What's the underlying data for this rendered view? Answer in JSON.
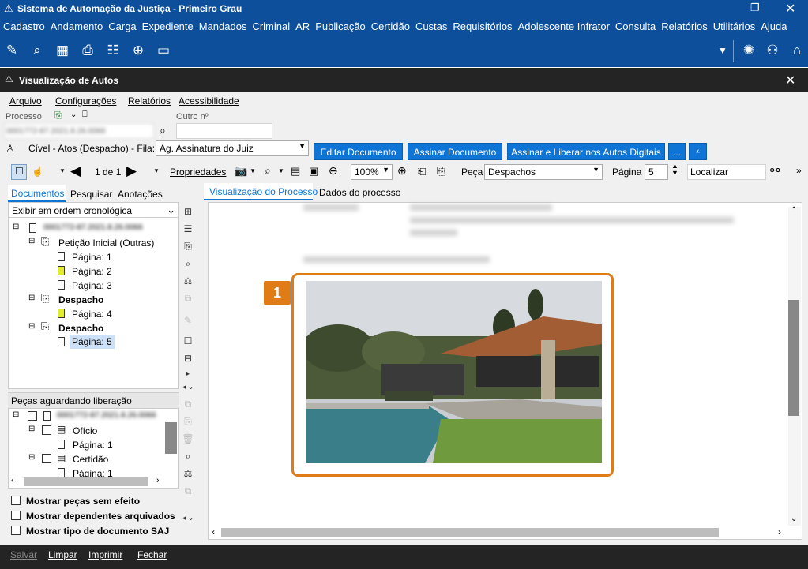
{
  "app": {
    "title": "Sistema de Automação da Justiça - Primeiro Grau"
  },
  "main_menu": [
    "Cadastro",
    "Andamento",
    "Carga",
    "Expediente",
    "Mandados",
    "Criminal",
    "AR",
    "Publicação",
    "Certidão",
    "Custas",
    "Requisitórios",
    "Adolescente Infrator",
    "Consulta",
    "Relatórios",
    "Utilitários",
    "Ajuda"
  ],
  "window": {
    "title": "Visualização de Autos"
  },
  "inner_menu": [
    "Arquivo",
    "Configurações",
    "Relatórios",
    "Acessibilidade"
  ],
  "fields": {
    "processo_label": "Processo",
    "outro_label": "Outro nº",
    "processo_value": "0001772-87.2021.8.26.0066",
    "fila_text": "Cível - Atos (Despacho) - Fila:",
    "fila_value": "Ag. Assinatura do Juiz"
  },
  "buttons": {
    "editar": "Editar Documento",
    "assinar": "Assinar Documento",
    "assinar_liberar": "Assinar e Liberar nos Autos Digitais",
    "more": "..."
  },
  "nav": {
    "page_of": "1 de 1",
    "propriedades": "Propriedades",
    "zoom": "100%",
    "peca_label": "Peça",
    "peca_value": "Despachos",
    "pagina_label": "Página",
    "pagina_value": "5",
    "localizar_placeholder": "Localizar"
  },
  "left_tabs": [
    "Documentos",
    "Pesquisar",
    "Anotações"
  ],
  "order_select": "Exibir em ordem cronológica",
  "tree": {
    "root": "0001772-87.2021.8.26.0066",
    "items": [
      {
        "label": "Petição Inicial (Outras)",
        "bold": false
      },
      {
        "label": "Página: 1"
      },
      {
        "label": "Página: 2"
      },
      {
        "label": "Página: 3"
      },
      {
        "label": "Despacho",
        "bold": true
      },
      {
        "label": "Página: 4"
      },
      {
        "label": "Despacho",
        "bold": true
      },
      {
        "label": "Página: 5",
        "selected": true
      }
    ]
  },
  "pending": {
    "title": "Peças aguardando liberação",
    "root": "0001772-87.2021.8.26.0066",
    "items": [
      "Ofício",
      "Página: 1",
      "Certidão",
      "Página: 1"
    ]
  },
  "checkboxes": [
    "Mostrar peças sem efeito",
    "Mostrar dependentes arquivados",
    "Mostrar tipo de documento SAJ"
  ],
  "content_tabs": [
    "Visualização do Processo",
    "Dados do processo"
  ],
  "annotation": {
    "badge": "1"
  },
  "footer": [
    "Salvar",
    "Limpar",
    "Imprimir",
    "Fechar"
  ],
  "colors": {
    "accent": "#0e74d6",
    "title_bar": "#0d4f9b",
    "annotation": "#e07c16",
    "dark_bar": "#242424"
  }
}
